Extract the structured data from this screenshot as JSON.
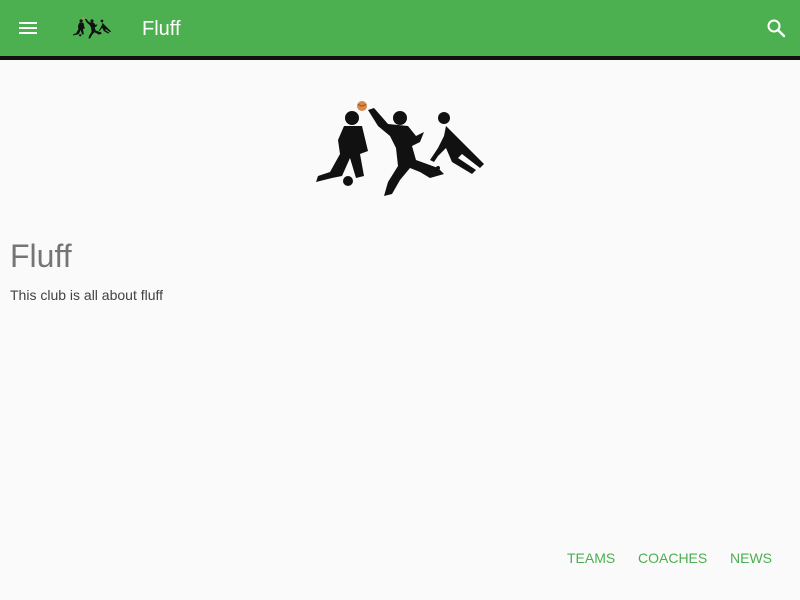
{
  "toolbar": {
    "title": "Fluff",
    "menu_icon": "menu-icon",
    "search_icon": "search-icon",
    "logo": "sports-silhouettes-logo",
    "background": "#4caf50"
  },
  "club": {
    "name": "Fluff",
    "description": "This club is all about fluff",
    "logo": "sports-silhouettes-logo"
  },
  "nav": {
    "teams_label": "TEAMS",
    "coaches_label": "COACHES",
    "news_label": "NEWS",
    "color": "#4caf50"
  }
}
